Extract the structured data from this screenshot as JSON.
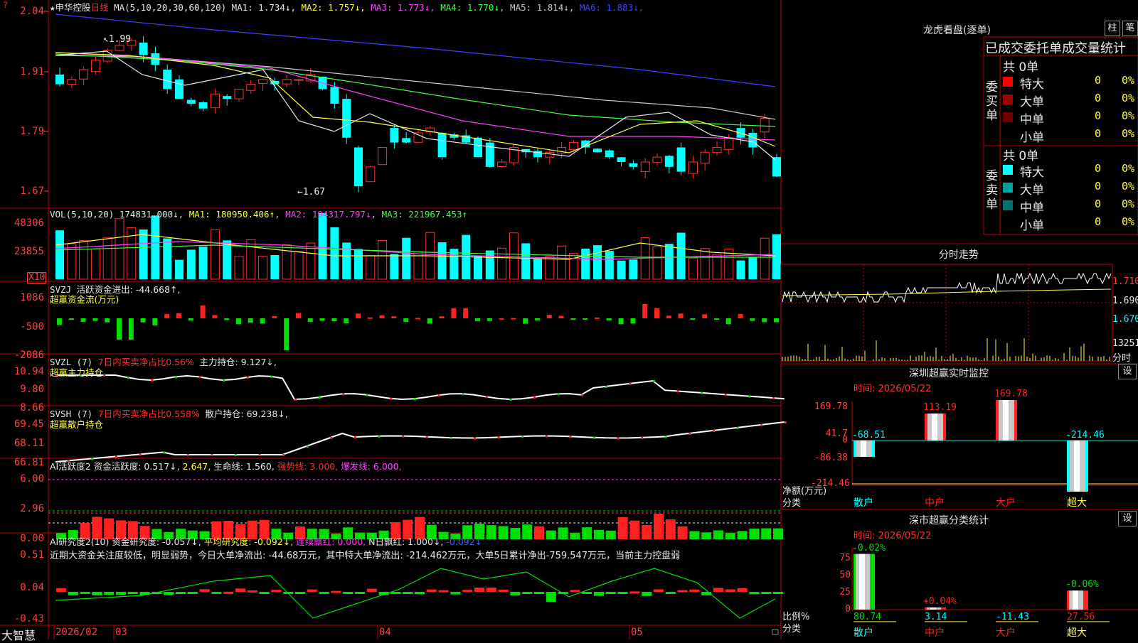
{
  "stock": {
    "star": "★",
    "name": "申华控股",
    "period": "日线",
    "ma_label": "MA(5,10,20,30,60,120)",
    "ma": [
      {
        "label": "MA1:",
        "value": "1.734",
        "arrow": "↓",
        "color": "#e8e8e8"
      },
      {
        "label": "MA2:",
        "value": "1.757",
        "arrow": "↓",
        "color": "#ffff40"
      },
      {
        "label": "MA3:",
        "value": "1.773",
        "arrow": "↓",
        "color": "#ff40ff"
      },
      {
        "label": "MA4:",
        "value": "1.770",
        "arrow": "↓",
        "color": "#40ff40"
      },
      {
        "label": "MA5:",
        "value": "1.814",
        "arrow": "↓",
        "color": "#c8c8c8"
      },
      {
        "label": "MA6:",
        "value": "1.883",
        "arrow": "↓",
        "color": "#4040ff"
      }
    ],
    "price_axis": [
      "2.04",
      "1.91",
      "1.79",
      "1.67"
    ],
    "high_mark": "1.99",
    "low_mark": "1.67"
  },
  "volume": {
    "title": "VOL(5,10,20)",
    "value": "174831.000↓",
    "ma1": "MA1: 180950.406↑",
    "ma2": "MA2: 194317.797↓",
    "ma3": "MA3: 221967.453↑",
    "axis": [
      "48306",
      "23855"
    ],
    "unit": "X10"
  },
  "svzj": {
    "title": "SVZJ",
    "label": "活跃资金进出: -44.668↑,",
    "sub": "超赢资金流(万元)",
    "axis": [
      "1086",
      "-500",
      "-2086"
    ]
  },
  "svzl": {
    "title": "SVZL (7)",
    "red": "7日内买卖净占比0.56%",
    "label": "主力持仓: 9.127↓,",
    "sub": "超赢主力持仓",
    "axis": [
      "10.94",
      "9.80",
      "8.66"
    ]
  },
  "svsh": {
    "title": "SVSH (7)",
    "red": "7日内买卖净占比0.558%",
    "label": "散户持仓: 69.238↓,",
    "sub": "超赢散户持仓",
    "axis": [
      "69.45",
      "68.11",
      "66.81"
    ]
  },
  "ai1": {
    "title": "AI活跃度2",
    "a": "资金活跃度: 0.517↓,",
    "b": "2.647,",
    "c": "生命线: 1.560,",
    "d": "强势线: 3.000,",
    "e": "爆发线: 6.000,",
    "axis": [
      "6.00",
      "2.96",
      "0.00"
    ]
  },
  "ai2": {
    "title": "AI研究度2(10)",
    "a": "资金研究度: -0.057↓,",
    "b": "平均研究度: -0.092↓,",
    "c": "连续飘红: 0.000,",
    "d": "N日飘红: 1.000↓,",
    "e": "-0.092↓",
    "note": "近期大资金关注度较低，明显弱势，今日大单净流出: -44.68万元，其中特大单净流出: -214.462万元，大单5日累计净出-759.547万元，当前主力控盘弱",
    "axis": [
      "0.51",
      "0.04",
      "-0.43"
    ]
  },
  "bottom": {
    "brand": "大智慧",
    "dates": [
      "2026/02",
      "03",
      "04",
      "05"
    ]
  },
  "dragon": {
    "title": "龙虎看盘(逐单)",
    "btn1": "柱",
    "btn2": "笔",
    "tabs": "已成交委托单成交量统计",
    "buy_side": "委买单",
    "sell_side": "委卖单",
    "buy_total": "共 0单",
    "sell_total": "共 0单",
    "buy_rows": [
      {
        "label": "特大",
        "count": "0",
        "pct": "0%",
        "color": "#ff0000"
      },
      {
        "label": "大单",
        "count": "0",
        "pct": "0%",
        "color": "#a00000"
      },
      {
        "label": "中单",
        "count": "0",
        "pct": "0%",
        "color": "#700000"
      },
      {
        "label": "小单",
        "count": "0",
        "pct": "0%",
        "color": ""
      }
    ],
    "sell_rows": [
      {
        "label": "特大",
        "count": "0",
        "pct": "0%",
        "color": "#00ffff"
      },
      {
        "label": "大单",
        "count": "0",
        "pct": "0%",
        "color": "#00a0a0"
      },
      {
        "label": "中单",
        "count": "0",
        "pct": "0%",
        "color": "#007070"
      },
      {
        "label": "小单",
        "count": "0",
        "pct": "0%",
        "color": ""
      }
    ]
  },
  "intraday": {
    "title": "分时走势",
    "axis": [
      "1.710",
      "1.690",
      "1.670"
    ],
    "vol": "13251",
    "vol_unit": "分时"
  },
  "sz_monitor": {
    "title": "深圳超赢实时监控",
    "btn": "设",
    "time": "时间: 2026/05/22",
    "axis": [
      "169.78",
      "41.7",
      "0",
      "-86.38",
      "-214.46"
    ],
    "y_label": "净额(万元)",
    "x_label": "分类",
    "categories": [
      "散户",
      "中户",
      "大户",
      "超大"
    ],
    "values": [
      "-68.51",
      "113.19",
      "169.78",
      "-214.46"
    ]
  },
  "sz_class": {
    "title": "深市超赢分类统计",
    "btn": "设",
    "time": "时间: 2026/05/22",
    "axis": [
      "75",
      "50",
      "25",
      "0"
    ],
    "y_label": "比例%",
    "x_label": "分类",
    "categories": [
      "散户",
      "中户",
      "大户",
      "超大"
    ],
    "top_labels": [
      "-0.02%",
      "+0.04%",
      "",
      "-0.06%"
    ],
    "values": [
      "80.74",
      "3.14",
      "-11.43",
      "27.56"
    ]
  }
}
